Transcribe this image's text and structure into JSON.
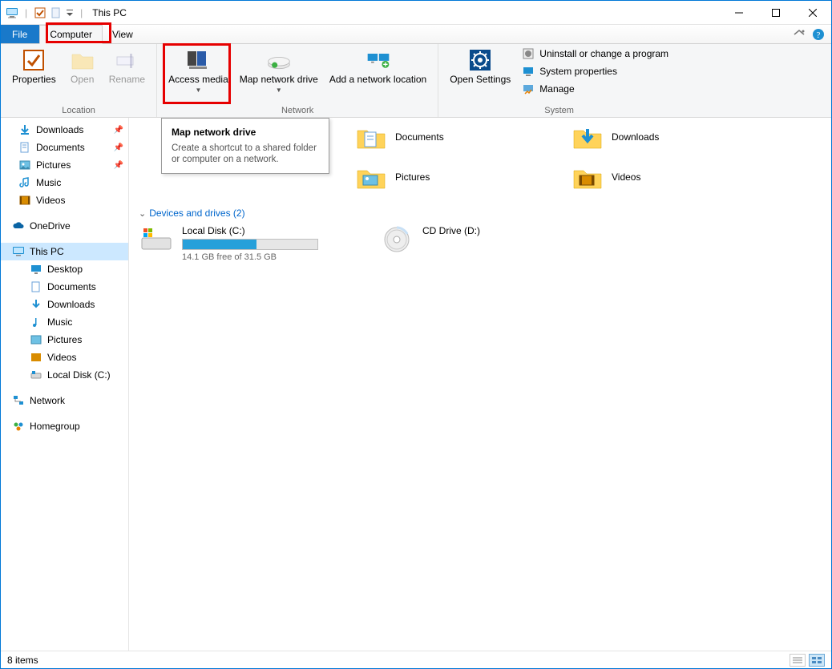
{
  "window": {
    "title": "This PC"
  },
  "tabs": {
    "file": "File",
    "computer": "Computer",
    "view": "View"
  },
  "ribbon": {
    "location": {
      "title": "Location",
      "properties": "Properties",
      "open": "Open",
      "rename": "Rename"
    },
    "network": {
      "title": "Network",
      "access_media": "Access media",
      "map_drive": "Map network drive",
      "add_location": "Add a network location"
    },
    "open_settings": "Open Settings",
    "system": {
      "title": "System",
      "uninstall": "Uninstall or change a program",
      "properties": "System properties",
      "manage": "Manage"
    }
  },
  "tooltip": {
    "title": "Map network drive",
    "body": "Create a shortcut to a shared folder or computer on a network."
  },
  "nav": {
    "downloads": "Downloads",
    "documents": "Documents",
    "pictures": "Pictures",
    "music": "Music",
    "videos": "Videos",
    "onedrive": "OneDrive",
    "thispc": "This PC",
    "desktop": "Desktop",
    "localdisk": "Local Disk (C:)",
    "network": "Network",
    "homegroup": "Homegroup"
  },
  "content": {
    "documents": "Documents",
    "downloads": "Downloads",
    "pictures": "Pictures",
    "videos": "Videos",
    "section_devices": "Devices and drives (2)",
    "drive_c": {
      "name": "Local Disk (C:)",
      "sub": "14.1 GB free of 31.5 GB",
      "fill_pct": 55
    },
    "drive_d": {
      "name": "CD Drive (D:)"
    }
  },
  "status": {
    "items": "8 items"
  }
}
